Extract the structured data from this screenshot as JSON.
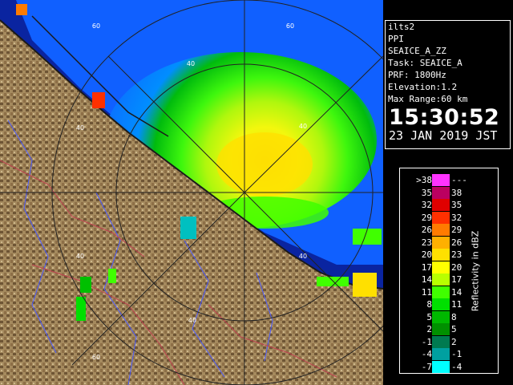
{
  "info": {
    "station": "ilts2",
    "scan_mode": "PPI",
    "product": "SEAICE_A_ZZ",
    "task": "Task: SEAICE_A",
    "prf": "PRF: 1800Hz",
    "elevation": "Elevation:1.2",
    "max_range": "Max Range:60 km",
    "time": "15:30:52",
    "date": "23 JAN 2019 JST"
  },
  "legend": {
    "title": "Reflectivity in dBZ",
    "rows": [
      {
        "lo": ">38",
        "hi": "---",
        "color": "#ff33ff"
      },
      {
        "lo": "35",
        "hi": "38",
        "color": "#bb0060"
      },
      {
        "lo": "32",
        "hi": "35",
        "color": "#e00000"
      },
      {
        "lo": "29",
        "hi": "32",
        "color": "#ff3000"
      },
      {
        "lo": "26",
        "hi": "29",
        "color": "#ff7b00"
      },
      {
        "lo": "23",
        "hi": "26",
        "color": "#ffb000"
      },
      {
        "lo": "20",
        "hi": "23",
        "color": "#ffe000"
      },
      {
        "lo": "17",
        "hi": "20",
        "color": "#ffff00"
      },
      {
        "lo": "14",
        "hi": "17",
        "color": "#b8ff00"
      },
      {
        "lo": "11",
        "hi": "14",
        "color": "#40ff00"
      },
      {
        "lo": "8",
        "hi": "11",
        "color": "#00e000"
      },
      {
        "lo": "5",
        "hi": "8",
        "color": "#00b800"
      },
      {
        "lo": "2",
        "hi": "5",
        "color": "#009000"
      },
      {
        "lo": "-1",
        "hi": "2",
        "color": "#007a50"
      },
      {
        "lo": "-4",
        "hi": "-1",
        "color": "#00a0a0"
      },
      {
        "lo": "-7",
        "hi": "-4",
        "color": "#00ffff"
      }
    ]
  },
  "range_labels": [
    "60",
    "40",
    "40",
    "40",
    "40",
    "40",
    "60"
  ],
  "colors": {
    "sea_echo": "#1060ff",
    "land": "#a58a5e",
    "range_ring": "#222222",
    "coastline": "#1a1a1a"
  }
}
